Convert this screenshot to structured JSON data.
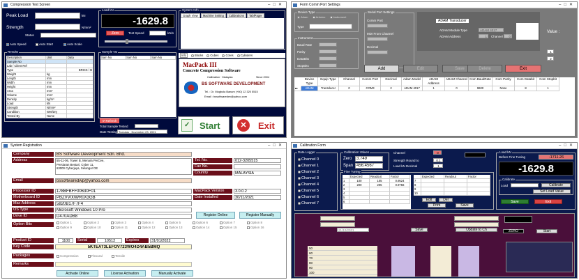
{
  "w1": {
    "title": "Compression Test Screen",
    "peak_load_label": "Peak Load",
    "peak_unit": "kN",
    "strength_label": "Strength",
    "strength_unit": "N/mm²",
    "status_label": "Status",
    "auto_speed": "Auto Speed",
    "auto_start": "Auto Start",
    "auto_scale": "Auto Scale",
    "load_kn_label": "Load kN",
    "load_value": "-1629.8",
    "zero_btn": "Zero",
    "test_speed_label": "Test Speed",
    "test_speed_unit": "kN/s",
    "sysinfo_label": "System Info",
    "sys_tabs": [
      "Graph View",
      "Machine Setting",
      "Calibrations",
      "TablPager"
    ],
    "results_label": "Results",
    "results_cols": [
      "Description",
      "Unit",
      "Data"
    ],
    "results_rows": [
      [
        "Sample No",
        "",
        ""
      ],
      [
        "Lab / Client Ref",
        "",
        ""
      ],
      [
        "Type",
        "",
        "BRICK / B"
      ],
      [
        "Weight",
        "kg",
        ""
      ],
      [
        "Length",
        "mm",
        ""
      ],
      [
        "Width",
        "mm",
        ""
      ],
      [
        "Height",
        "mm",
        ""
      ],
      [
        "Area",
        "mm²",
        ""
      ],
      [
        "Volume",
        "mm³",
        ""
      ],
      [
        "Density",
        "kg/m³",
        ""
      ],
      [
        "Load",
        "kN",
        ""
      ],
      [
        "Strength",
        "N/mm²",
        ""
      ],
      [
        "Condition",
        "Wet/Dry",
        ""
      ],
      [
        "Tested By",
        "Name",
        ""
      ]
    ],
    "sample_no_label": "Sample No",
    "sample_cols": [
      "Sam No",
      "Sam No",
      "Sam No"
    ],
    "type_tabs": [
      "Blocks",
      "Cubes",
      "Cores",
      "Cylinders"
    ],
    "brand_title": "MacPack III",
    "brand_sub": "Concrete Compression Software",
    "co_line1": "Calibration · Malaysia",
    "co_line2": "Since 2004",
    "bs_name": "BS SOFTWARE DEVELOPMENT",
    "bs_tel": "Tel. : Dr. Mogbola Banam (+60) 12 320 5515",
    "bs_email": "Email : bssoftwaredev@yahoo.com",
    "refresh_btn": "Refresh",
    "total_sample_label": "Total Sample Tested",
    "date_testing_label": "Date Testing",
    "date_testing": "Tuesday , November 23, 2021",
    "start_btn": "Start",
    "exit_btn": "Exit"
  },
  "w2": {
    "title": "Form Comm Port Settings",
    "device_type_label": "Device Type",
    "dev_radios": [
      "Adam",
      "Arduino",
      "Instrument"
    ],
    "type_label": "Type",
    "instrument_label": "Instrument",
    "inst_fields": [
      "Baud Rate",
      "Parity",
      "DataBits",
      "StopBits"
    ],
    "serial_label": "Serial Port Settings",
    "comm_port_label": "Comm Port",
    "mdi_label": "MDI From Channel",
    "decimal_label": "Decimal",
    "adam_label": "ADAM Transducer",
    "adam_module_label": "ADAM Module Type",
    "adam_module_val": "ADAM 4017",
    "adam_addr_label": "ADAM Address",
    "adam_addr_val": "1",
    "channel_label": "Channel",
    "channel_val": "0",
    "value_label": "Value :",
    "small_vals": [
      "1",
      "2"
    ],
    "btns": [
      "Add",
      "Edit",
      "Save",
      "Delete",
      "Exit"
    ],
    "grid_cols": [
      "Device Type",
      "Equip Type",
      "Channel",
      "Comm Port",
      "Decimal",
      "Adam Model",
      "ADAM Address",
      "ADAM Channel",
      "Com BaudRate",
      "Com Parity",
      "Com Databit",
      "Com Stopbit"
    ],
    "grid_row": [
      "ADAM",
      "Transducer",
      "0",
      "COM3",
      "2",
      "ADAM 4017",
      "1",
      "0",
      "9600",
      "None",
      "8",
      "1"
    ]
  },
  "w3": {
    "title": "System Registration",
    "company_label": "Company",
    "company_val": "BS Software Development Sdn. Bhd.",
    "address_label": "Address",
    "address_lines": [
      "55-11-06, Tower B, Menara PerCee,",
      "Persiaran Bestari, Cyber 11,",
      "63000 Cyberjaya, Selangor DE"
    ],
    "tel_label": "Tel. No.",
    "tel_val": "012-3205515",
    "fax_label": "Fax No.",
    "fax_val": "",
    "country_label": "Country",
    "country_val": "MALAYSIA",
    "email_label": "Email",
    "email_val": "bssoftwaredwp@yahoo.com",
    "processor_label": "Processor ID",
    "processor_val": "178BFBFF00630F01",
    "motherboard_label": "Motherboard ID",
    "motherboard_val": "PBZVV00WR0X3GB",
    "mac_label": "Mac Address",
    "mac_val": "5820B17F7F4",
    "os_label": "OS Type",
    "os_val": "Microsoft Windows 10 Pro",
    "drive_label": "Drive ID",
    "drive_val": "D470ADB8",
    "option_label": "Option Bits",
    "options": [
      "Option 1",
      "Option 2",
      "Option 3",
      "Option 4",
      "Option 5",
      "Option 6",
      "Option 7",
      "Option 8",
      "Option 9",
      "Option 10",
      "Option 11",
      "Option 12",
      "Option 13",
      "Option 14",
      "Option 15",
      "Option 16"
    ],
    "macpack_label": "MacPack Version",
    "macpack_val": "3.0.0.2",
    "installed_label": "Date Installed",
    "installed_val": "30/11/2021",
    "reg_online": "Register Online",
    "reg_manual": "Register Manually",
    "product_label": "Product ID",
    "product_val": "1100",
    "serial_label": "Serial",
    "serial_val": "10512",
    "expires_label": "Expires",
    "expires_val": "31/01/2022",
    "key_label": "Key Code",
    "key_val": "5KTEAT3LEFOV723WO4D4AB5BMQ",
    "packages_label": "Packages",
    "packages": [
      "Compression",
      "Flexural",
      "Tensile"
    ],
    "remarks_label": "Remarks",
    "activate_online": "Activate Online",
    "license_activation": "License Activation",
    "manual_activate": "Manually Activate"
  },
  "w4": {
    "title": "Calibration Form",
    "logger_label": "Data Logger",
    "channels": [
      "Channel 0",
      "Channel 1",
      "Channel 2",
      "Channel 3",
      "Channel 4",
      "Channel 5",
      "Channel 6",
      "Channel 7"
    ],
    "cal_values_label": "Calibration Values",
    "zero_label": "Zero",
    "zero_val": "3.749",
    "span_label": "Span",
    "span_val": "456.4567",
    "channel_label": "Channel",
    "channel_val": "0",
    "strength_round_label": "Strength Round to",
    "strength_round_val": "0.1",
    "load_decimal_label": "Load kN Decimal",
    "load_decimal_val": "1",
    "fine_tuning_label": "Fine Tuning",
    "ft_cols": [
      "Expected",
      "Readout",
      "Factor"
    ],
    "ft_left_idx": [
      "1",
      "2",
      "3",
      "4",
      "5",
      "6"
    ],
    "ft_left_rows": [
      [
        "100",
        "105",
        "0.9524"
      ],
      [
        "200",
        "205",
        "0.9756"
      ]
    ],
    "ft_right_idx": [
      "7",
      "8",
      "9",
      "10"
    ],
    "edit_btn": "Edit",
    "del_btn": "Del",
    "print_btn": "Print",
    "save_btn_small": "Save",
    "loadkn_label": "Load kN",
    "before_fine_label": "Before Fine Tuning",
    "before_fine_val": "-1711.26",
    "loadkn_big": "-1629.8",
    "calibrate_label": "Calibrate",
    "cal_load_label": "Load",
    "calibrate_btn": "Calibrate",
    "set_load_btn": "Set Load Value",
    "save_btn": "Save",
    "exit_btn": "Exit",
    "date_val": "21/12/2021",
    "save2_btn": "Save",
    "update_btn": "Update to Ch",
    "zero_btn": "ZERO",
    "start_btn": "Start",
    "lower_idx": [
      "50",
      "60",
      "70",
      "80",
      "90",
      "100"
    ]
  }
}
